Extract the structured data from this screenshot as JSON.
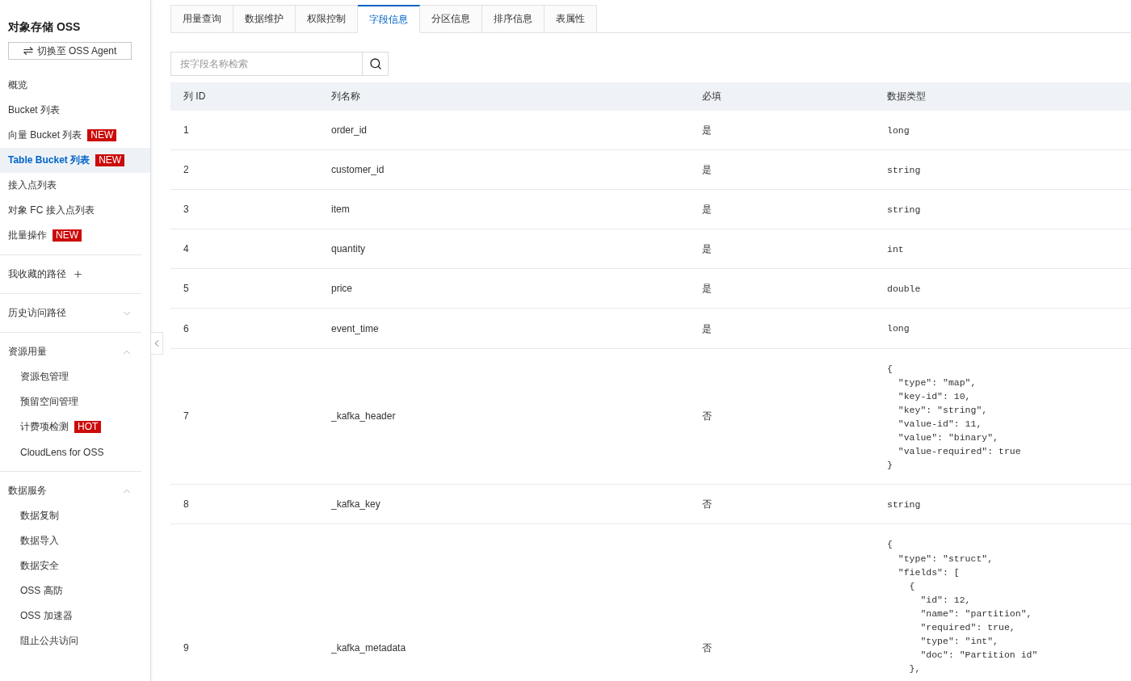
{
  "sidebar": {
    "title": "对象存储 OSS",
    "switch_button": "切换至 OSS Agent",
    "nav_items": [
      {
        "label": "概览",
        "selected": false
      },
      {
        "label": "Bucket 列表",
        "selected": false
      },
      {
        "label": "向量 Bucket 列表",
        "badge": "NEW",
        "selected": false
      },
      {
        "label": "Table Bucket 列表",
        "badge": "NEW",
        "selected": true
      },
      {
        "label": "接入点列表",
        "selected": false
      },
      {
        "label": "对象 FC 接入点列表",
        "selected": false
      },
      {
        "label": "批量操作",
        "badge": "NEW",
        "selected": false
      }
    ],
    "favorites": {
      "label": "我收藏的路径"
    },
    "sections": [
      {
        "label": "历史访问路径",
        "expanded": false
      },
      {
        "label": "资源用量",
        "expanded": true,
        "children": [
          {
            "label": "资源包管理",
            "selected": false
          },
          {
            "label": "预留空间管理",
            "selected": false
          },
          {
            "label": "计费项检测",
            "badge": "HOT",
            "selected": false
          },
          {
            "label": "CloudLens for OSS",
            "selected": false
          }
        ]
      },
      {
        "label": "数据服务",
        "expanded": true,
        "children": [
          {
            "label": "数据复制",
            "selected": false
          },
          {
            "label": "数据导入",
            "selected": false
          },
          {
            "label": "数据安全",
            "selected": false
          },
          {
            "label": "OSS 高防",
            "selected": false
          },
          {
            "label": "OSS 加速器",
            "selected": false
          },
          {
            "label": "阻止公共访问",
            "selected": false
          }
        ]
      }
    ]
  },
  "tabs": [
    {
      "label": "用量查询",
      "selected": false
    },
    {
      "label": "数据维护",
      "selected": false
    },
    {
      "label": "权限控制",
      "selected": false
    },
    {
      "label": "字段信息",
      "selected": true
    },
    {
      "label": "分区信息",
      "selected": false
    },
    {
      "label": "排序信息",
      "selected": false
    },
    {
      "label": "表属性",
      "selected": false
    }
  ],
  "search": {
    "placeholder": "按字段名称检索"
  },
  "table": {
    "columns": [
      "列 ID",
      "列名称",
      "必填",
      "数据类型"
    ],
    "rows": [
      {
        "id": "1",
        "name": "order_id",
        "required": "是",
        "data_type": "long"
      },
      {
        "id": "2",
        "name": "customer_id",
        "required": "是",
        "data_type": "string"
      },
      {
        "id": "3",
        "name": "item",
        "required": "是",
        "data_type": "string"
      },
      {
        "id": "4",
        "name": "quantity",
        "required": "是",
        "data_type": "int"
      },
      {
        "id": "5",
        "name": "price",
        "required": "是",
        "data_type": "double"
      },
      {
        "id": "6",
        "name": "event_time",
        "required": "是",
        "data_type": "long"
      },
      {
        "id": "7",
        "name": "_kafka_header",
        "required": "否",
        "data_type": "{\n  \"type\": \"map\",\n  \"key-id\": 10,\n  \"key\": \"string\",\n  \"value-id\": 11,\n  \"value\": \"binary\",\n  \"value-required\": true\n}"
      },
      {
        "id": "8",
        "name": "_kafka_key",
        "required": "否",
        "data_type": "string"
      },
      {
        "id": "9",
        "name": "_kafka_metadata",
        "required": "否",
        "data_type": "{\n  \"type\": \"struct\",\n  \"fields\": [\n    {\n      \"id\": 12,\n      \"name\": \"partition\",\n      \"required\": true,\n      \"type\": \"int\",\n      \"doc\": \"Partition id\"\n    },"
      }
    ]
  }
}
